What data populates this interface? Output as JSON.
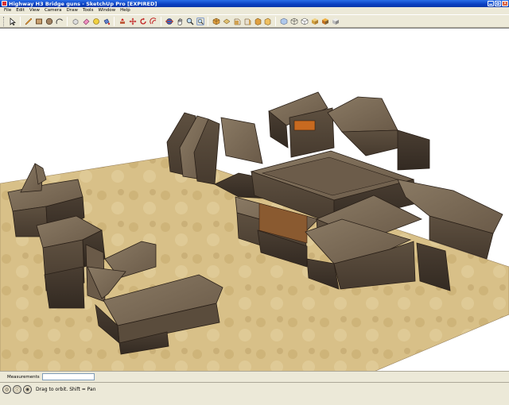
{
  "window": {
    "title": "Highway H3 Bridge guns - SketchUp Pro [EXPIRED]",
    "accent_color": "#0a3fc0"
  },
  "menu": {
    "items": [
      "File",
      "Edit",
      "View",
      "Camera",
      "Draw",
      "Tools",
      "Window",
      "Help"
    ]
  },
  "toolbar": {
    "tools": [
      {
        "name": "select",
        "icon": "arrow-cursor-icon"
      },
      {
        "name": "pencil",
        "icon": "pencil-icon"
      },
      {
        "name": "rectangle",
        "icon": "rectangle-icon"
      },
      {
        "name": "circle",
        "icon": "circle-icon"
      },
      {
        "name": "arc",
        "icon": "arc-icon"
      },
      {
        "name": "make-component",
        "icon": "component-icon"
      },
      {
        "name": "eraser",
        "icon": "eraser-icon"
      },
      {
        "name": "tape-measure",
        "icon": "tape-measure-icon"
      },
      {
        "name": "paint-bucket",
        "icon": "paint-bucket-icon"
      },
      {
        "name": "push-pull",
        "icon": "push-pull-icon"
      },
      {
        "name": "move",
        "icon": "move-icon"
      },
      {
        "name": "rotate",
        "icon": "rotate-icon"
      },
      {
        "name": "offset",
        "icon": "offset-icon"
      },
      {
        "name": "orbit",
        "icon": "orbit-icon"
      },
      {
        "name": "pan",
        "icon": "pan-icon"
      },
      {
        "name": "zoom",
        "icon": "zoom-icon"
      },
      {
        "name": "zoom-extents",
        "icon": "zoom-extents-icon"
      },
      {
        "name": "iso-view",
        "icon": "iso-view-icon"
      },
      {
        "name": "top-view",
        "icon": "top-view-icon"
      },
      {
        "name": "front-view",
        "icon": "front-view-icon"
      },
      {
        "name": "right-view",
        "icon": "right-view-icon"
      },
      {
        "name": "back-view",
        "icon": "back-view-icon"
      },
      {
        "name": "left-view",
        "icon": "left-view-icon"
      },
      {
        "name": "xray",
        "icon": "xray-icon"
      },
      {
        "name": "wireframe",
        "icon": "wireframe-icon"
      },
      {
        "name": "hidden-line",
        "icon": "hidden-line-icon"
      },
      {
        "name": "shaded",
        "icon": "shaded-icon"
      },
      {
        "name": "shaded-textures",
        "icon": "shaded-textures-icon"
      },
      {
        "name": "monochrome",
        "icon": "monochrome-icon"
      }
    ]
  },
  "status": {
    "measurements_label": "Measurements",
    "measurements_value": "",
    "hint": "Drag to orbit.  Shift = Pan"
  }
}
